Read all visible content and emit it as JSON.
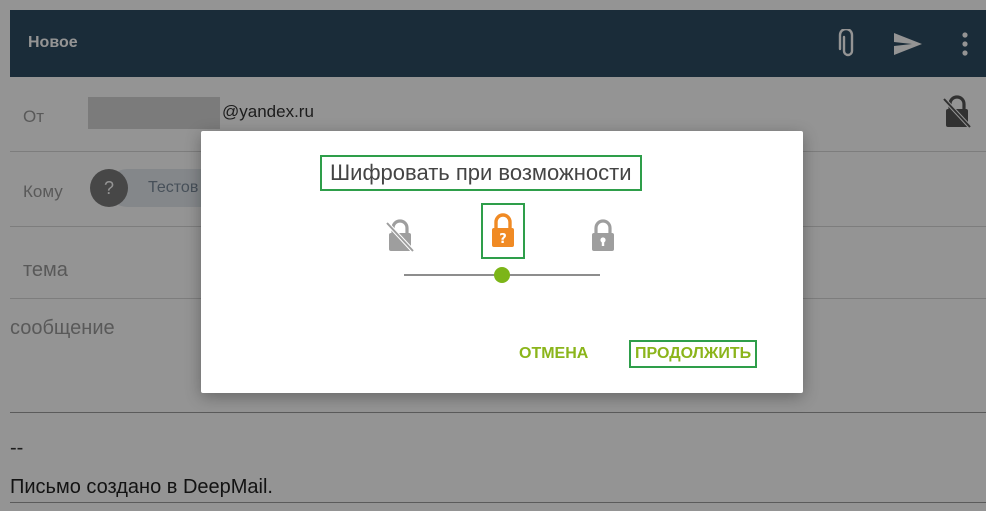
{
  "appbar": {
    "title": "Новое",
    "icons": [
      "paperclip-icon",
      "send-icon",
      "more-vert-icon"
    ],
    "color": "#2e4d63"
  },
  "compose": {
    "from_label": "От",
    "from_domain": "@yandex.ru",
    "to_label": "Кому",
    "to_avatar": "?",
    "to_chip": "Тестов",
    "subject_placeholder": "тема",
    "message_placeholder": "сообщение",
    "signature_dash": "--",
    "signature": "Письмо создано в DeepMail."
  },
  "dialog": {
    "title": "Шифровать при возможности",
    "lock_options": [
      "lock-off-icon",
      "lock-maybe-icon",
      "lock-on-icon"
    ],
    "selected_option": 1,
    "cancel_label": "ОТМЕНА",
    "continue_label": "ПРОДОЛЖИТЬ",
    "accent_color": "#8bb51b",
    "selected_lock_color": "#f08a24"
  }
}
